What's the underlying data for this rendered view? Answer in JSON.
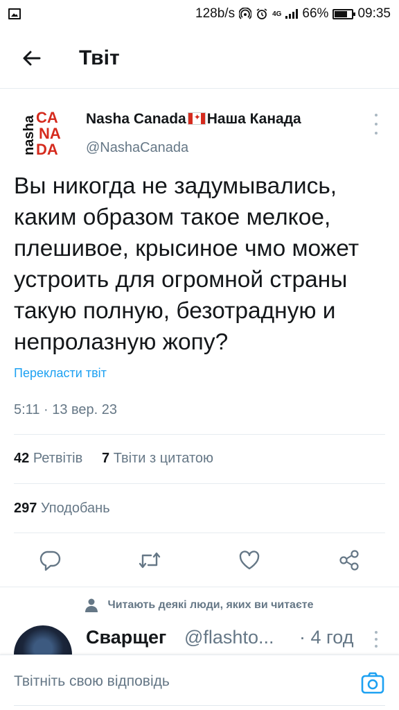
{
  "status_bar": {
    "net_speed": "128b/s",
    "network_type": "4G",
    "battery": "66%",
    "battery_level": 0.66,
    "time": "09:35"
  },
  "header": {
    "title": "Твіт",
    "back_icon": "arrow-left-icon"
  },
  "tweet": {
    "author_name_part1": "Nasha Canada",
    "author_name_part2": "Наша Канада",
    "flag_icon": "canada-flag-icon",
    "handle": "@NashaCanada",
    "avatar_text": {
      "vertical": "nasha",
      "line1": "CA",
      "line2": "NA",
      "line3": "DA"
    },
    "text": "Вы никогда не задумывались, каким образом такое мелкое, плешивое, крысиное чмо может устроить для огромной страны такую полную, безотрадную и непролазную жопу?",
    "translate_label": "Перекласти твіт",
    "timestamp": "5:11 · 13 вер. 23",
    "retweets_count": "42",
    "retweets_label": "Ретвітів",
    "quotes_count": "7",
    "quotes_label": "Твіти з цитатою",
    "likes_count": "297",
    "likes_label": "Уподобань"
  },
  "actions": {
    "reply_icon": "reply-icon",
    "retweet_icon": "retweet-icon",
    "like_icon": "heart-icon",
    "share_icon": "share-icon"
  },
  "followed_note": {
    "icon": "person-icon",
    "text": "Читають деякі люди, яких ви читаєте"
  },
  "reply": {
    "name": "Сварщег",
    "handle": "@flashto...",
    "time": "· 4 год"
  },
  "compose": {
    "placeholder": "Твітніть свою відповідь",
    "camera_icon": "camera-icon"
  },
  "colors": {
    "accent": "#1da1f2",
    "secondary_text": "#657786",
    "brand_red": "#d52b1e"
  }
}
